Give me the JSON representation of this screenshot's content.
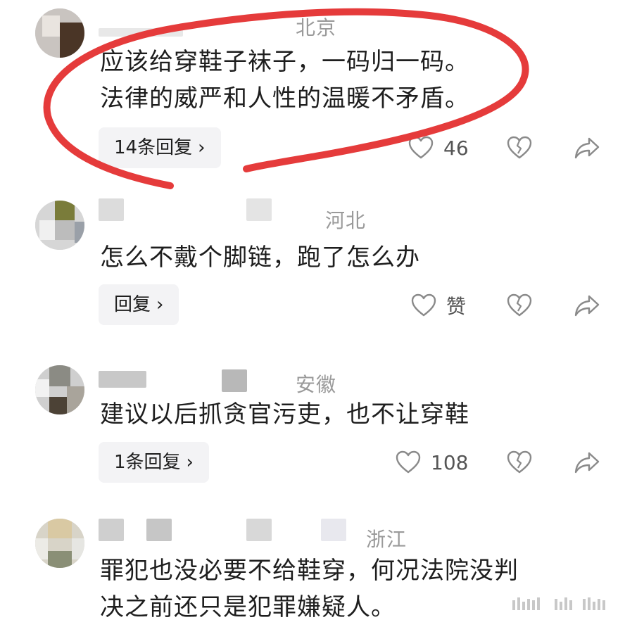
{
  "comments": [
    {
      "region": "北京",
      "text": "应该给穿鞋子袜子，一码归一码。\n法律的威严和人性的温暖不矛盾。",
      "reply_label": "14条回复",
      "like_count": "46",
      "icons": {
        "like": "heart-outline-icon",
        "dislike": "broken-heart-icon",
        "share": "share-arrow-icon"
      }
    },
    {
      "region": "河北",
      "text": "怎么不戴个脚链，跑了怎么办",
      "reply_label": "回复",
      "like_count": "赞",
      "icons": {
        "like": "heart-outline-icon",
        "dislike": "broken-heart-icon",
        "share": "share-arrow-icon"
      }
    },
    {
      "region": "安徽",
      "text": "建议以后抓贪官污吏，也不让穿鞋",
      "reply_label": "1条回复",
      "like_count": "108",
      "icons": {
        "like": "heart-outline-icon",
        "dislike": "broken-heart-icon",
        "share": "share-arrow-icon"
      }
    },
    {
      "region": "浙江",
      "text": "罪犯也没必要不给鞋穿，何况法院没判\n决之前还只是犯罪嫌疑人。",
      "reply_label": "",
      "like_count": "",
      "icons": {}
    }
  ],
  "colors": {
    "annotation_circle": "#e53b3b",
    "reply_bg": "#f3f3f5",
    "region_text": "#9a9a9a",
    "icon_stroke": "#8a8a8a"
  }
}
